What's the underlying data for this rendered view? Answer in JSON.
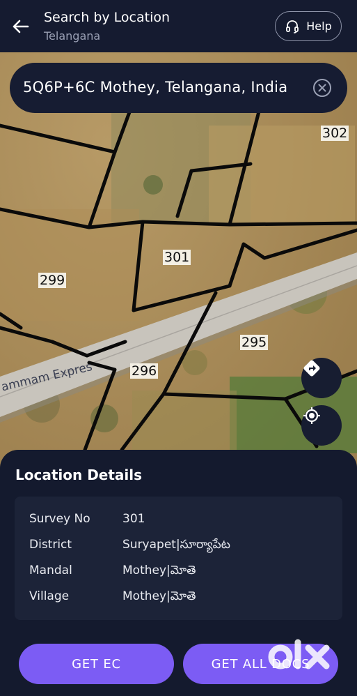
{
  "header": {
    "title": "Search by Location",
    "subtitle": "Telangana",
    "help_label": "Help"
  },
  "search": {
    "value": "5Q6P+6C Mothey, Telangana, India"
  },
  "map": {
    "survey_labels": [
      "302",
      "301",
      "299",
      "295",
      "296"
    ],
    "road_label": "ammam Expres"
  },
  "sheet": {
    "title": "Location Details",
    "details": [
      {
        "label": "Survey No",
        "value": "301"
      },
      {
        "label": "District",
        "value": "Suryapet|సూర్యాపేట"
      },
      {
        "label": "Mandal",
        "value": "Mothey|మోతె"
      },
      {
        "label": "Village",
        "value": "Mothey|మోతె"
      }
    ],
    "buttons": {
      "get_ec": "GET EC",
      "get_all_docs": "GET ALL DOCS"
    }
  },
  "watermark": "olx",
  "colors": {
    "accent": "#7c5cf4",
    "background": "#141a2e",
    "card": "#1c2338"
  }
}
